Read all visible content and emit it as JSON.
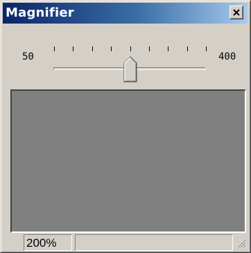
{
  "window": {
    "title": "Magnifier",
    "close_icon": "close-x-icon",
    "colors": {
      "titlebar_start": "#0a246a",
      "titlebar_end": "#a6caf0",
      "face": "#d4d0c8",
      "view_background": "#808080"
    }
  },
  "slider": {
    "min_label": "50",
    "max_label": "400",
    "min": 50,
    "max": 400,
    "value": 200,
    "tick_count": 9,
    "thumb_icon": "slider-thumb-icon"
  },
  "status": {
    "zoom": "200%",
    "message": "",
    "grip_icon": "resize-grip-icon"
  }
}
